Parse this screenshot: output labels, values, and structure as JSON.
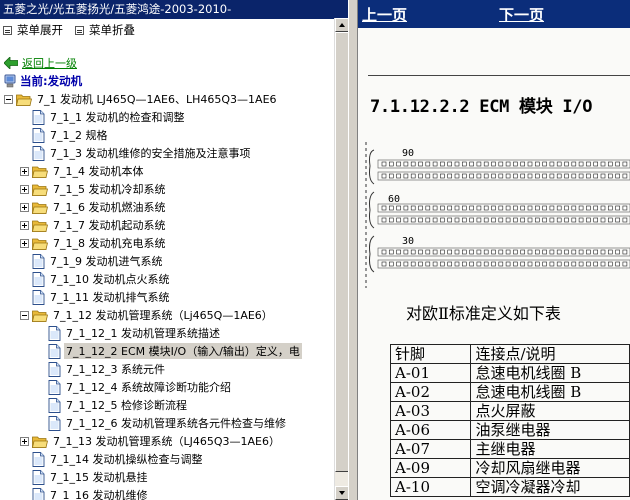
{
  "left_pane": {
    "title": "五菱之光/光五菱扬光/五菱鸿途-2003-2010-",
    "menu_expand": "菜单展开",
    "menu_collapse": "菜单折叠",
    "back_link": "返回上一级",
    "current_label": "当前:发动机"
  },
  "tree": [
    {
      "label": "7_1 发动机  LJ465Q—1AE6、LH465Q3—1AE6",
      "level": 0,
      "kind": "folder",
      "toggle": "minus"
    },
    {
      "label": "7_1_1 发动机的检查和调整",
      "level": 1,
      "kind": "doc"
    },
    {
      "label": "7_1_2 规格",
      "level": 1,
      "kind": "doc"
    },
    {
      "label": "7_1_3 发动机维修的安全措施及注意事项",
      "level": 1,
      "kind": "doc"
    },
    {
      "label": "7_1_4 发动机本体",
      "level": 1,
      "kind": "folder",
      "toggle": "plus"
    },
    {
      "label": "7_1_5 发动机冷却系统",
      "level": 1,
      "kind": "folder",
      "toggle": "plus"
    },
    {
      "label": "7_1_6 发动机燃油系统",
      "level": 1,
      "kind": "folder",
      "toggle": "plus"
    },
    {
      "label": "7_1_7 发动机起动系统",
      "level": 1,
      "kind": "folder",
      "toggle": "plus"
    },
    {
      "label": "7_1_8 发动机充电系统",
      "level": 1,
      "kind": "folder",
      "toggle": "plus"
    },
    {
      "label": "7_1_9 发动机进气系统",
      "level": 1,
      "kind": "doc"
    },
    {
      "label": "7_1_10 发动机点火系统",
      "level": 1,
      "kind": "doc"
    },
    {
      "label": "7_1_11 发动机排气系统",
      "level": 1,
      "kind": "doc"
    },
    {
      "label": "7_1_12 发动机管理系统（Lj465Q—1AE6）",
      "level": 1,
      "kind": "folder",
      "toggle": "minus"
    },
    {
      "label": "7_1_12_1 发动机管理系统描述",
      "level": 2,
      "kind": "doc"
    },
    {
      "label": "7_1_12_2 ECM 模块I/O（输入/输出）定义，电",
      "level": 2,
      "kind": "doc",
      "selected": true
    },
    {
      "label": "7_1_12_3 系统元件",
      "level": 2,
      "kind": "doc"
    },
    {
      "label": "7_1_12_4 系统故障诊断功能介绍",
      "level": 2,
      "kind": "doc"
    },
    {
      "label": "7_1_12_5 检修诊断流程",
      "level": 2,
      "kind": "doc"
    },
    {
      "label": "7_1_12_6 发动机管理系统各元件检查与维修",
      "level": 2,
      "kind": "doc"
    },
    {
      "label": "7_1_13 发动机管理系统（LJ465Q3—1AE6）",
      "level": 1,
      "kind": "folder",
      "toggle": "plus"
    },
    {
      "label": "7_1_14 发动机操纵检查与调整",
      "level": 1,
      "kind": "doc"
    },
    {
      "label": "7_1_15 发动机悬挂",
      "level": 1,
      "kind": "doc"
    },
    {
      "label": "7_1_16 发动机维修",
      "level": 1,
      "kind": "doc"
    }
  ],
  "right_pane": {
    "prev_page": "上一页",
    "next_page": "下一页",
    "heading": "7.1.12.2.2 ECM 模块 I/O",
    "connector_labels": [
      "90",
      "60",
      "30"
    ],
    "subheading": "对欧Ⅱ标准定义如下表",
    "table": {
      "headers": [
        "针脚",
        "连接点/说明"
      ],
      "rows": [
        [
          "A-01",
          "怠速电机线圈 B"
        ],
        [
          "A-02",
          "怠速电机线圈 B"
        ],
        [
          "A-03",
          "点火屏蔽"
        ],
        [
          "A-06",
          "油泵继电器"
        ],
        [
          "A-07",
          "主继电器"
        ],
        [
          "A-09",
          "冷却风扇继电器"
        ],
        [
          "A-10",
          "空调冷凝器冷却"
        ]
      ]
    }
  },
  "colors": {
    "title_bar": "#0a246a",
    "nav_bar": "#0b2d7a",
    "back_link": "#008000",
    "current_label": "#0000aa",
    "selected_row": "#d4d0c8",
    "folder": "#f5d463"
  },
  "icons": {
    "menu_controls": "list-icon",
    "back": "green-left-arrow-icon",
    "current": "computer-icon",
    "folder": "open-folder-icon",
    "document": "document-icon",
    "toggle": "tree-expand-collapse-icon"
  }
}
